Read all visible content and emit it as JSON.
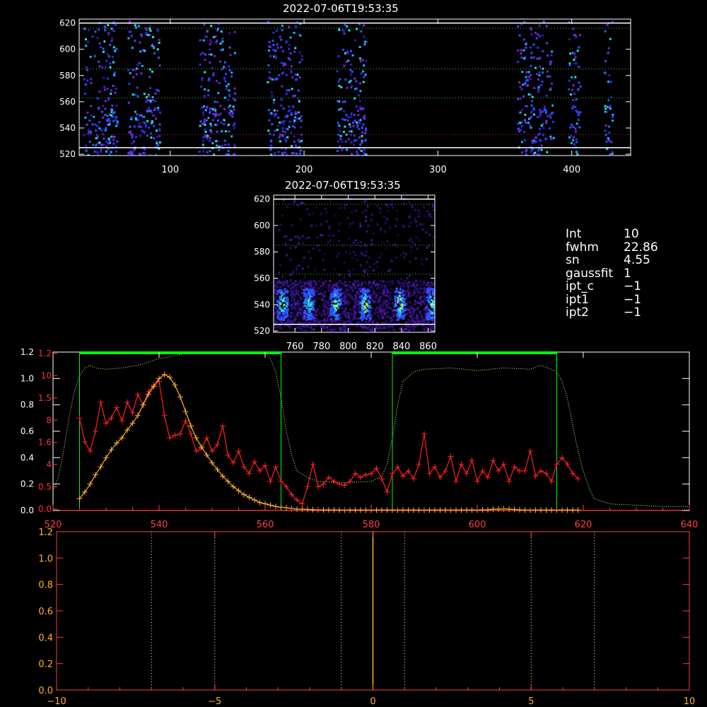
{
  "images": [
    {
      "title": "2022-07-06T19:53:35",
      "xlim": [
        32,
        444
      ],
      "ylim": [
        519,
        623
      ],
      "xticks": [
        100,
        200,
        300,
        400
      ],
      "yticks": [
        520,
        540,
        560,
        580,
        600,
        620
      ],
      "hlines_white": [
        525,
        620
      ],
      "hlines_green_dotted": [
        563,
        585,
        616
      ],
      "hline_red_dotted": 535,
      "columns": [
        [
          35,
          60
        ],
        [
          68,
          92
        ],
        [
          121,
          148
        ],
        [
          172,
          198
        ],
        [
          224,
          246
        ],
        [
          359,
          386
        ],
        [
          397,
          406
        ],
        [
          424,
          430
        ]
      ]
    },
    {
      "title": "2022-07-06T19:53:35",
      "xlim": [
        744,
        865
      ],
      "ylim": [
        519,
        623
      ],
      "xticks": [
        760,
        780,
        800,
        820,
        840,
        860
      ],
      "yticks": [
        520,
        540,
        560,
        580,
        600,
        620
      ],
      "hlines_white": [
        525,
        620
      ],
      "hlines_green_dotted": [
        563,
        585,
        616
      ],
      "peaks_x": [
        750,
        770,
        790,
        812,
        838,
        862
      ]
    }
  ],
  "params": [
    {
      "key": "Int",
      "value": "10"
    },
    {
      "key": "fwhm",
      "value": "22.86"
    },
    {
      "key": "sn",
      "value": "4.55"
    },
    {
      "key": "gaussfit",
      "value": "1"
    },
    {
      "key": "ipt_c",
      "value": "−1"
    },
    {
      "key": "ipt1",
      "value": "−1"
    },
    {
      "key": "ipt2",
      "value": "−1"
    }
  ],
  "chart_data": [
    {
      "type": "line",
      "xlim": [
        520,
        640
      ],
      "ylim": [
        0,
        1.2
      ],
      "xticks": [
        520,
        540,
        560,
        580,
        600,
        620,
        640
      ],
      "yticks_white": [
        0.0,
        0.2,
        0.4,
        0.6,
        0.8,
        1.0,
        1.2
      ],
      "yticks_red_labels": [
        "0.0",
        "0.5",
        "4",
        "1.6",
        "8",
        "1.5",
        "10",
        "1.2"
      ],
      "windows": [
        [
          525,
          563
        ],
        [
          584,
          615
        ]
      ],
      "colors": {
        "spectrum": "#ff2020",
        "model": "#ffb030",
        "filter": "#c8ff80",
        "window": "#00ff00",
        "axis": "#ff4040"
      },
      "series": [
        {
          "x": [
            525,
            526,
            527,
            528,
            529,
            530,
            531,
            532,
            533,
            534,
            535,
            536,
            537,
            538,
            539,
            540,
            541,
            542,
            543,
            544,
            545,
            546,
            547,
            548,
            549,
            550,
            551,
            552,
            553,
            554,
            555,
            556,
            557,
            558,
            559,
            560,
            561,
            562,
            563,
            564,
            565,
            566,
            567,
            568,
            569,
            570,
            571,
            572,
            573,
            574,
            575,
            576,
            577,
            578,
            579,
            580,
            581,
            582,
            583,
            584,
            585,
            586,
            587,
            588,
            589,
            590,
            591,
            592,
            593,
            594,
            595,
            596,
            597,
            598,
            599,
            600,
            601,
            602,
            603,
            604,
            605,
            606,
            607,
            608,
            609,
            610,
            611,
            612,
            613,
            614,
            615,
            616,
            617,
            618,
            619
          ],
          "y": [
            0.7,
            0.52,
            0.45,
            0.6,
            0.82,
            0.66,
            0.7,
            0.78,
            0.68,
            0.82,
            0.74,
            0.88,
            0.8,
            0.9,
            0.95,
            0.98,
            0.72,
            0.55,
            0.57,
            0.58,
            0.68,
            0.58,
            0.45,
            0.47,
            0.55,
            0.45,
            0.5,
            0.64,
            0.42,
            0.36,
            0.45,
            0.33,
            0.28,
            0.37,
            0.3,
            0.34,
            0.22,
            0.33,
            0.22,
            0.18,
            0.12,
            0.08,
            0.05,
            0.18,
            0.35,
            0.18,
            0.2,
            0.25,
            0.22,
            0.2,
            0.19,
            0.22,
            0.28,
            0.25,
            0.27,
            0.28,
            0.32,
            0.24,
            0.14,
            0.28,
            0.33,
            0.26,
            0.3,
            0.24,
            0.35,
            0.58,
            0.28,
            0.33,
            0.25,
            0.3,
            0.41,
            0.22,
            0.35,
            0.28,
            0.38,
            0.22,
            0.3,
            0.25,
            0.38,
            0.3,
            0.35,
            0.22,
            0.33,
            0.3,
            0.3,
            0.45,
            0.26,
            0.3,
            0.28,
            0.22,
            0.35,
            0.4,
            0.35,
            0.28,
            0.24
          ]
        },
        {
          "x": [
            525,
            526,
            527,
            528,
            529,
            530,
            531,
            532,
            533,
            534,
            535,
            536,
            537,
            538,
            539,
            540,
            541,
            542,
            543,
            544,
            545,
            546,
            547,
            548,
            549,
            550,
            551,
            552,
            553,
            554,
            555,
            556,
            557,
            558,
            559,
            560,
            561,
            562,
            563,
            564,
            565,
            566,
            567,
            568,
            569,
            570,
            571,
            572,
            573,
            574,
            575,
            576,
            577,
            578,
            579,
            580,
            581,
            582,
            583,
            584,
            585,
            586,
            587,
            588,
            589,
            590,
            591,
            592,
            593,
            594,
            595,
            596,
            597,
            598,
            599,
            600,
            601,
            602,
            603,
            604,
            605,
            606,
            607,
            608,
            609,
            610,
            611,
            612,
            613,
            614,
            615,
            616,
            617,
            618,
            619
          ],
          "y": [
            0.09,
            0.14,
            0.2,
            0.27,
            0.33,
            0.4,
            0.46,
            0.51,
            0.55,
            0.61,
            0.66,
            0.72,
            0.8,
            0.88,
            0.94,
            1.0,
            1.03,
            1.01,
            0.95,
            0.86,
            0.75,
            0.64,
            0.55,
            0.48,
            0.42,
            0.36,
            0.31,
            0.26,
            0.22,
            0.18,
            0.15,
            0.12,
            0.1,
            0.08,
            0.06,
            0.05,
            0.04,
            0.03,
            0.025,
            0.02,
            0.015,
            0.01,
            0.01,
            0.008,
            0.006,
            0.005,
            0.004,
            0.004,
            0.004,
            0.003,
            0.003,
            0.003,
            0.003,
            0.003,
            0.003,
            0.003,
            0.003,
            0.003,
            0.003,
            0.003,
            0.003,
            0.003,
            0.003,
            0.003,
            0.003,
            0.003,
            0.003,
            0.003,
            0.003,
            0.003,
            0.003,
            0.003,
            0.003,
            0.003,
            0.003,
            0.003,
            0.005,
            0.005,
            0.01,
            0.01,
            0.012,
            0.01,
            0.008,
            0.005,
            0.003,
            0.003,
            0.003,
            0.003,
            0.003,
            0.003,
            0.003,
            0.003,
            0.003,
            0.003,
            0.003
          ]
        },
        {
          "x": [
            520,
            521,
            522,
            523,
            524,
            525,
            526,
            527,
            528,
            530,
            533,
            536,
            540,
            545,
            550,
            555,
            558,
            560,
            561,
            562,
            563,
            564,
            565,
            566,
            568,
            570,
            575,
            580,
            582,
            583,
            584,
            585,
            586,
            588,
            590,
            595,
            600,
            605,
            610,
            612,
            614,
            615,
            616,
            617,
            618,
            619,
            620,
            621,
            622,
            625,
            630,
            635,
            640
          ],
          "y": [
            0.15,
            0.25,
            0.45,
            0.7,
            0.9,
            1.02,
            1.08,
            1.1,
            1.08,
            1.07,
            1.08,
            1.1,
            1.15,
            1.19,
            1.2,
            1.19,
            1.2,
            1.19,
            1.15,
            1.05,
            0.85,
            0.6,
            0.42,
            0.3,
            0.25,
            0.22,
            0.21,
            0.22,
            0.26,
            0.35,
            0.55,
            0.8,
            0.98,
            1.05,
            1.07,
            1.08,
            1.06,
            1.08,
            1.07,
            1.1,
            1.07,
            1.05,
            0.98,
            0.85,
            0.65,
            0.45,
            0.3,
            0.18,
            0.09,
            0.05,
            0.04,
            0.03,
            0.03
          ]
        }
      ]
    },
    {
      "type": "line",
      "xlim": [
        -10,
        10
      ],
      "ylim": [
        0,
        1.2
      ],
      "xticks": [
        -10,
        -5,
        0,
        5,
        10
      ],
      "yticks": [
        0.0,
        0.2,
        0.4,
        0.6,
        0.8,
        1.0,
        1.2
      ],
      "vlines_dotted": [
        -7,
        -5,
        -1,
        1,
        5,
        7
      ],
      "vline_solid": 0,
      "colors": {
        "axis": "#ff4040",
        "labels": "#ffb030",
        "guides": "#ffffa0",
        "center": "#ffb030"
      }
    }
  ]
}
